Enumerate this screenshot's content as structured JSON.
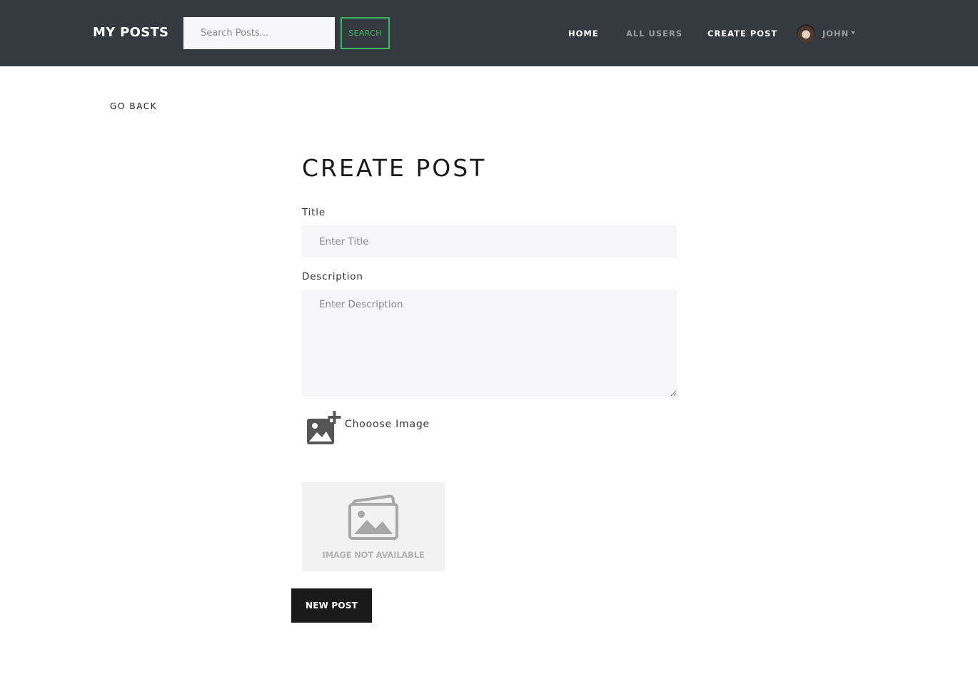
{
  "navbar": {
    "brand": "MY POSTS",
    "search_placeholder": "Search Posts...",
    "search_button": "SEARCH",
    "links": {
      "home": "HOME",
      "all_users": "ALL USERS",
      "create_post": "CREATE POST"
    },
    "user_name": "JOHN",
    "accent_color": "#3ab65d",
    "background_color": "#343a40"
  },
  "page": {
    "go_back": "GO BACK",
    "title": "CREATE POST"
  },
  "form": {
    "title_label": "Title",
    "title_placeholder": "Enter Title",
    "title_value": "",
    "description_label": "Description",
    "description_placeholder": "Enter Description",
    "description_value": "",
    "choose_image_label": "Chooose Image",
    "choose_image_icon": "add-photo-icon",
    "preview_text": "IMAGE NOT AVAILABLE",
    "preview_icon": "image-placeholder-icon",
    "submit_label": "NEW POST"
  }
}
